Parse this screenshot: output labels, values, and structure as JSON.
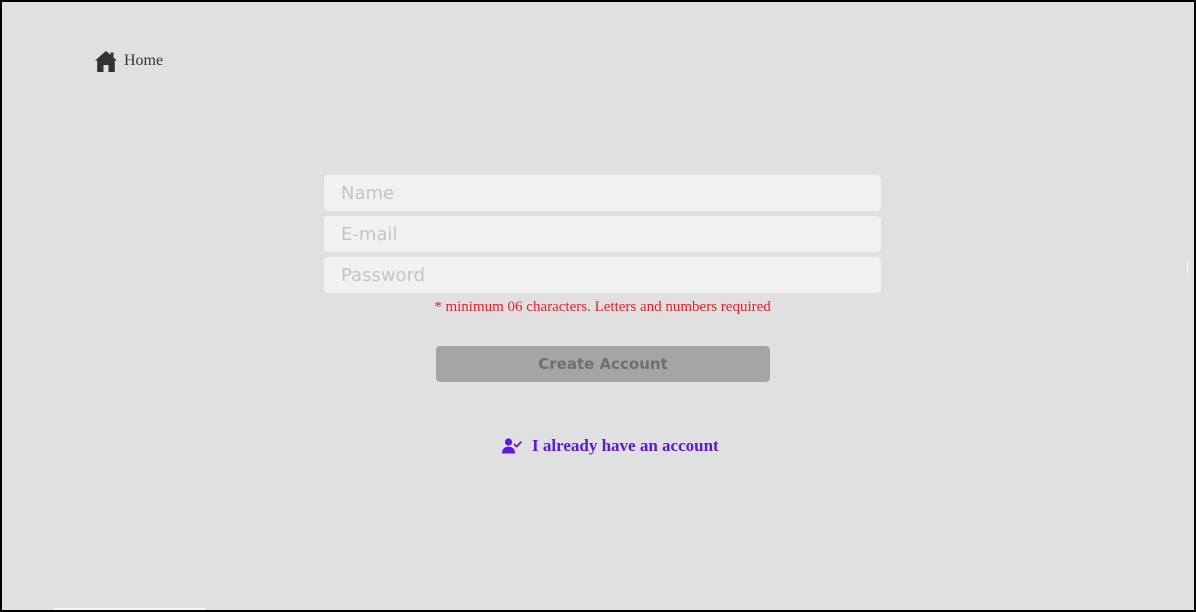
{
  "nav": {
    "home_label": "Home",
    "home_icon": "home-icon"
  },
  "form": {
    "name_placeholder": "Name",
    "email_placeholder": "E-mail",
    "password_placeholder": "Password",
    "password_hint": "* minimum 06 characters. Letters and numbers required",
    "submit_label": "Create Account"
  },
  "footer": {
    "login_label": "I already have an account",
    "login_icon": "user-check-icon"
  },
  "colors": {
    "background": "#e0e0e0",
    "input_background": "#f1f1f1",
    "button_background": "#a5a5a5",
    "hint": "#e8202a",
    "link_accent": "#5a18e0"
  }
}
